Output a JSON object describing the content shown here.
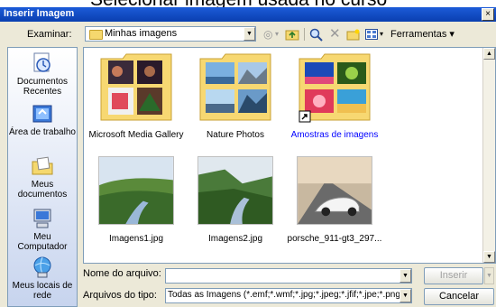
{
  "background_caption": "Selecionar imagem usada no curso",
  "window": {
    "title": "Inserir Imagem",
    "close_glyph": "×"
  },
  "lookin": {
    "label": "Examinar:",
    "value": "Minhas imagens"
  },
  "toolbar": {
    "tools_label": "Ferramentas"
  },
  "places": [
    {
      "label": "Documentos Recentes",
      "icon": "recent-documents-icon"
    },
    {
      "label": "Área de trabalho",
      "icon": "desktop-icon"
    },
    {
      "label": "Meus documentos",
      "icon": "my-documents-icon"
    },
    {
      "label": "Meu Computador",
      "icon": "my-computer-icon"
    },
    {
      "label": "Meus locais de rede",
      "icon": "network-places-icon"
    }
  ],
  "items": [
    {
      "label": "Microsoft Media Gallery",
      "type": "folder"
    },
    {
      "label": "Nature Photos",
      "type": "folder"
    },
    {
      "label": "Amostras de imagens",
      "type": "folder-shortcut",
      "color": "#0000ff"
    },
    {
      "label": "Imagens1.jpg",
      "type": "image"
    },
    {
      "label": "Imagens2.jpg",
      "type": "image"
    },
    {
      "label": "porsche_911-gt3_297...",
      "type": "image"
    }
  ],
  "filename": {
    "label": "Nome do arquivo:",
    "value": ""
  },
  "filetype": {
    "label": "Arquivos do tipo:",
    "value": "Todas as Imagens (*.emf;*.wmf;*.jpg;*.jpeg;*.jfif;*.jpe;*.png;"
  },
  "buttons": {
    "insert": "Inserir",
    "cancel": "Cancelar"
  }
}
